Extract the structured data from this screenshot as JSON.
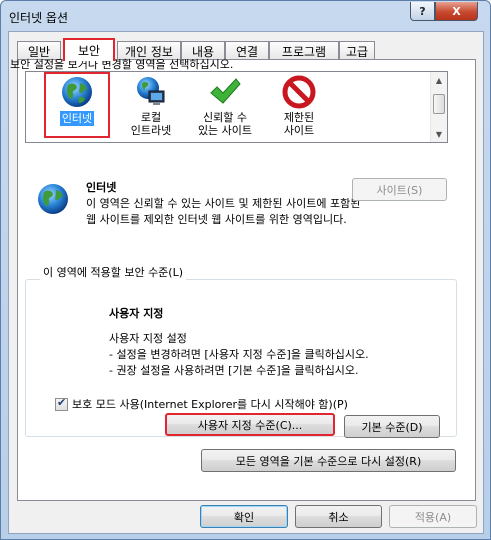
{
  "window": {
    "title": "인터넷 옵션",
    "help_label": "?",
    "close_label": "X"
  },
  "tabs": [
    {
      "label": "일반",
      "active": false
    },
    {
      "label": "보안",
      "active": true
    },
    {
      "label": "개인 정보",
      "active": false
    },
    {
      "label": "내용",
      "active": false
    },
    {
      "label": "연결",
      "active": false
    },
    {
      "label": "프로그램",
      "active": false
    },
    {
      "label": "고급",
      "active": false
    }
  ],
  "security": {
    "instruction": "보안 설정을 보거나 변경할 영역을 선택하십시오.",
    "zones": [
      {
        "label": "인터넷",
        "icon": "globe-icon",
        "selected": true
      },
      {
        "label": "로컬\n인트라넷",
        "icon": "local-intranet-icon",
        "selected": false
      },
      {
        "label": "신뢰할 수\n있는 사이트",
        "icon": "trusted-checkmark-icon",
        "selected": false
      },
      {
        "label": "제한된\n사이트",
        "icon": "restricted-sign-icon",
        "selected": false
      }
    ],
    "selected_zone": {
      "name": "인터넷",
      "description": "이 영역은 신뢰할 수 있는 사이트 및 제한된 사이트에 포함된 웹 사이트를 제외한 인터넷 웹 사이트를 위한 영역입니다."
    },
    "sites_button": "사이트(S)",
    "level_group_title": "이 영역에 적용할 보안 수준(L)",
    "custom_title": "사용자 지정",
    "custom_lines": [
      "사용자 지정 설정",
      "- 설정을 변경하려면 [사용자 지정 수준]을 클릭하십시오.",
      "- 권장 설정을 사용하려면 [기본 수준]을 클릭하십시오."
    ],
    "protected_mode_label": "보호 모드 사용(Internet Explorer를 다시 시작해야 함)(P)",
    "protected_mode_checked": true,
    "custom_level_button": "사용자 지정 수준(C)...",
    "default_level_button": "기본 수준(D)",
    "reset_all_button": "모든 영역을 기본 수준으로 다시 설정(R)"
  },
  "footer": {
    "ok": "확인",
    "cancel": "취소",
    "apply": "적용(A)"
  },
  "colors": {
    "highlight_red": "#e2262f",
    "selection_blue": "#3399ff"
  }
}
